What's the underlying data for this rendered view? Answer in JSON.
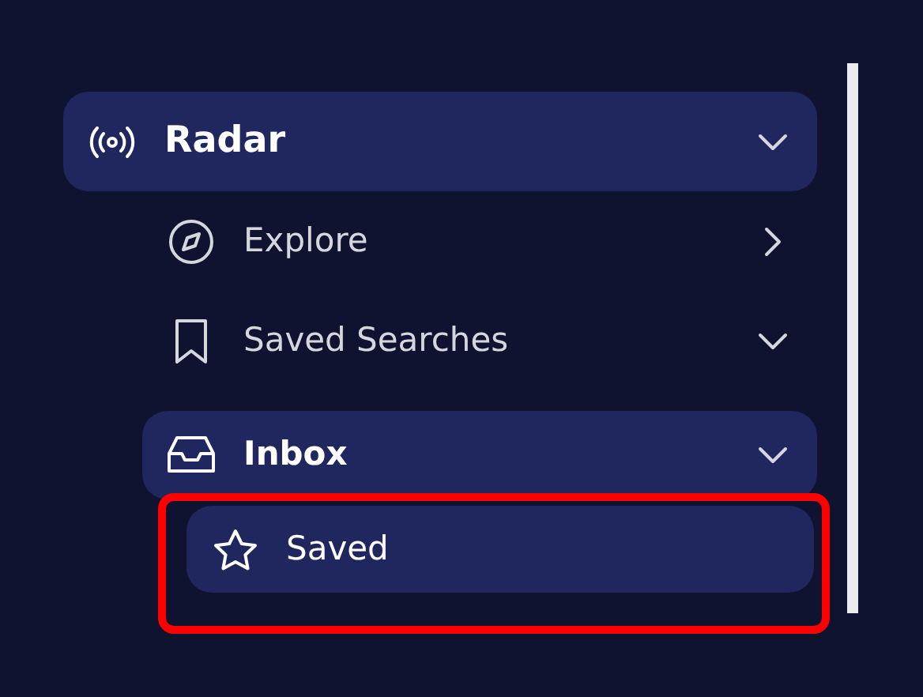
{
  "nav": [
    {
      "label": "Radar",
      "selected": true,
      "expanded": true,
      "children": [
        {
          "label": "Explore",
          "selected": false,
          "expanded": false
        },
        {
          "label": "Saved Searches",
          "selected": false,
          "expanded": true
        },
        {
          "label": "Inbox",
          "selected": true,
          "expanded": true,
          "children": [
            {
              "label": "Saved",
              "selected": true,
              "highlighted": true
            }
          ]
        }
      ]
    }
  ]
}
